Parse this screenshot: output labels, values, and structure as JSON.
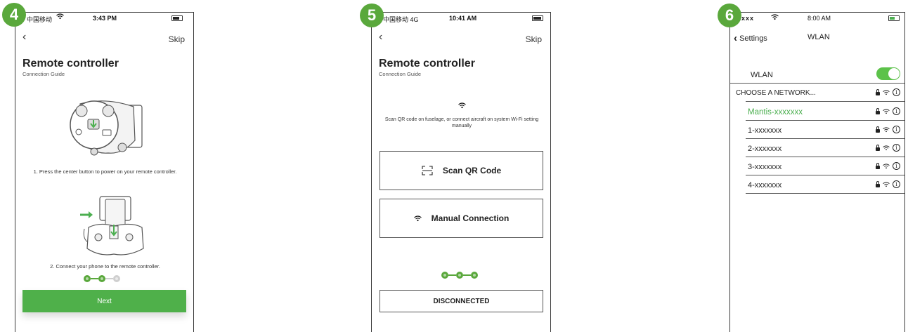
{
  "colors": {
    "accent_green": "#5aa83c",
    "button_green": "#4fb04a",
    "toggle_green": "#5cc24a"
  },
  "screens": [
    {
      "badge": "4",
      "status": {
        "carrier": "中国移动",
        "time": "3:43 PM"
      },
      "nav": {
        "skip": "Skip"
      },
      "title": "Remote controller",
      "subtitle": "Connection Guide",
      "step1": "1. Press the center button to power on your remote controller.",
      "step2": "2. Connect your phone to the remote controller.",
      "progress": {
        "current": 2,
        "total": 3
      },
      "next_button": "Next"
    },
    {
      "badge": "5",
      "status": {
        "carrier": "中国移动 4G",
        "time": "10:41 AM"
      },
      "nav": {
        "skip": "Skip"
      },
      "title": "Remote controller",
      "subtitle": "Connection Guide",
      "instruction": "Scan QR code on fuselage, or connect aircraft on system Wi-Fi setting manually",
      "scan_button": "Scan QR Code",
      "manual_button": "Manual Connection",
      "progress": {
        "current": 3,
        "total": 3
      },
      "status_button": "DISCONNECTED"
    },
    {
      "badge": "6",
      "status": {
        "carrier": "xxxx",
        "time": "8:00 AM"
      },
      "nav": {
        "back": "Settings",
        "title": "WLAN"
      },
      "wlan_label": "WLAN",
      "wlan_enabled": true,
      "choose_header": "CHOOSE A NETWORK...",
      "networks": [
        "Mantis-xxxxxxx",
        "1-xxxxxxx",
        "2-xxxxxxx",
        "3-xxxxxxx",
        "4-xxxxxxx"
      ],
      "connected_network": "Mantis-xxxxxxx"
    }
  ]
}
